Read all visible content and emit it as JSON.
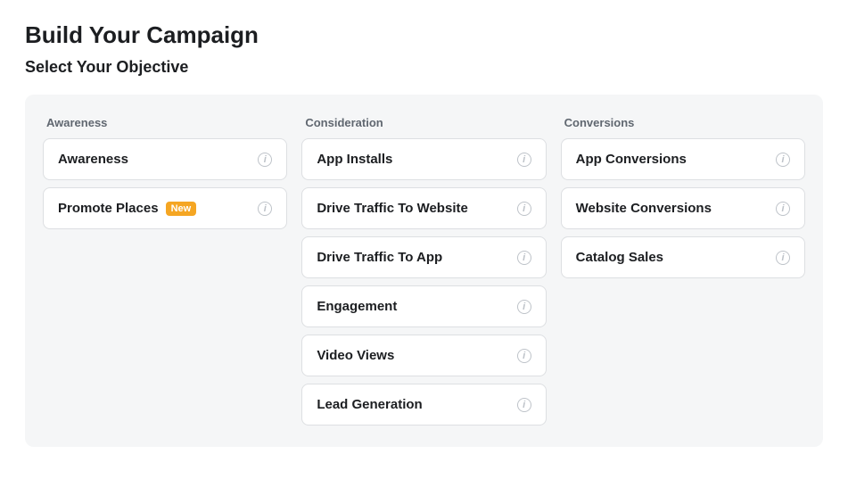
{
  "page": {
    "title": "Build Your Campaign",
    "subtitle": "Select Your Objective"
  },
  "columns": [
    {
      "id": "awareness",
      "title": "Awareness",
      "options": [
        {
          "id": "awareness",
          "label": "Awareness",
          "badge": null
        },
        {
          "id": "promote-places",
          "label": "Promote Places",
          "badge": "New"
        }
      ]
    },
    {
      "id": "consideration",
      "title": "Consideration",
      "options": [
        {
          "id": "app-installs",
          "label": "App Installs",
          "badge": null
        },
        {
          "id": "drive-traffic-website",
          "label": "Drive Traffic To Website",
          "badge": null
        },
        {
          "id": "drive-traffic-app",
          "label": "Drive Traffic To App",
          "badge": null
        },
        {
          "id": "engagement",
          "label": "Engagement",
          "badge": null
        },
        {
          "id": "video-views",
          "label": "Video Views",
          "badge": null
        },
        {
          "id": "lead-generation",
          "label": "Lead Generation",
          "badge": null
        }
      ]
    },
    {
      "id": "conversions",
      "title": "Conversions",
      "options": [
        {
          "id": "app-conversions",
          "label": "App Conversions",
          "badge": null
        },
        {
          "id": "website-conversions",
          "label": "Website Conversions",
          "badge": null
        },
        {
          "id": "catalog-sales",
          "label": "Catalog Sales",
          "badge": null
        }
      ]
    }
  ],
  "info_icon_label": "i"
}
